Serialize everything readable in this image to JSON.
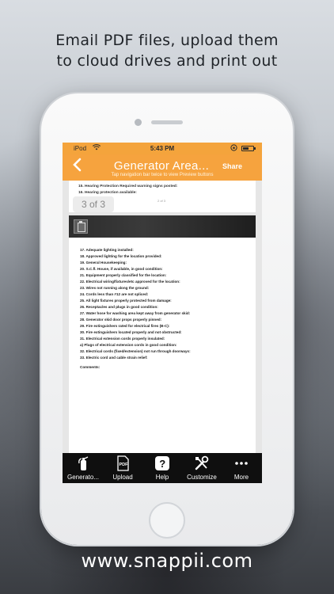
{
  "promo": {
    "headline_line1": "Email PDF files, upload them",
    "headline_line2": "to cloud drives and print out",
    "website": "www.snappii.com"
  },
  "status_bar": {
    "carrier": "iPod",
    "time": "5:43 PM",
    "icons": [
      "wifi-icon",
      "rotation-lock-icon",
      "battery-icon"
    ]
  },
  "nav_bar": {
    "back_icon": "chevron-left-icon",
    "title": "Generator Area...",
    "share_label": "Share",
    "hint": "Tap navigation bar twice to view Preview buttons",
    "accent_color": "#f6a33e"
  },
  "document": {
    "page1_rows": [
      "15. Hearing Protection Required warning signs posted:",
      "16. Hearing protection available:"
    ],
    "page_indicator": "3 of 3",
    "page_number_small": "2 of 3",
    "checklist": [
      "17. Adequate lighting installed:",
      "18. Approved lighting for the location provided:",
      "19. General Housekeeping:",
      "20. S.C.fl. House, if available, in good condition:",
      "21. Equipment properly classified for the location:",
      "22. Electrical wiring/fixtures/etc approved for the location:",
      "23. Wires not running along the ground:",
      "24. Cords less than #12 are not spliced:",
      "25. All light fixtures properly protected from damage:",
      "26. Receptacles and plugs in good condition:",
      "27. Water hose for washing area kept away from generator skid:",
      "28. Generator skid door props properly pinned:",
      "29. Fire extinguishers rated for electrical fires (B-C):",
      "30. Fire extinguishers located properly and not obstructed:",
      "31. Electrical extension cords properly insulated:",
      "a) Plugs of electrical extension cords in good condition:",
      "32. Electrical cords (fixed/extension) not run through doorways:",
      "33. Electric cord and cable strain relief:"
    ],
    "comments_label": "Comments:"
  },
  "tab_bar": {
    "items": [
      {
        "label": "Generato...",
        "icon": "fire-extinguisher-icon"
      },
      {
        "label": "Upload",
        "icon": "pdf-icon"
      },
      {
        "label": "Help",
        "icon": "help-icon"
      },
      {
        "label": "Customize",
        "icon": "tools-icon"
      },
      {
        "label": "More",
        "icon": "more-icon"
      }
    ]
  }
}
